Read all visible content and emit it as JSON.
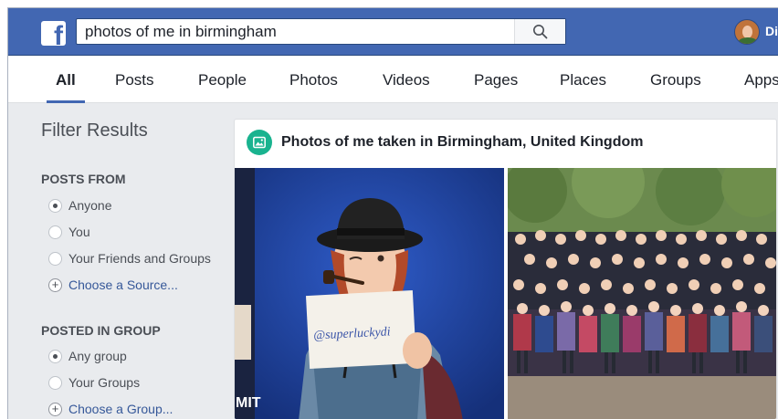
{
  "header": {
    "logo_letter": "f",
    "search_value": "photos of me in birmingham",
    "user_name_partial": "Di"
  },
  "tabs": [
    {
      "label": "All",
      "active": true
    },
    {
      "label": "Posts",
      "active": false
    },
    {
      "label": "People",
      "active": false
    },
    {
      "label": "Photos",
      "active": false
    },
    {
      "label": "Videos",
      "active": false
    },
    {
      "label": "Pages",
      "active": false
    },
    {
      "label": "Places",
      "active": false
    },
    {
      "label": "Groups",
      "active": false
    },
    {
      "label": "Apps",
      "active": false
    }
  ],
  "sidebar": {
    "title": "Filter Results",
    "posts_from": {
      "heading": "POSTS FROM",
      "options": [
        {
          "label": "Anyone",
          "selected": true
        },
        {
          "label": "You",
          "selected": false
        },
        {
          "label": "Your Friends and Groups",
          "selected": false
        }
      ],
      "choose_link": "Choose a Source..."
    },
    "posted_in_group": {
      "heading": "POSTED IN GROUP",
      "options": [
        {
          "label": "Any group",
          "selected": true
        },
        {
          "label": "Your Groups",
          "selected": false
        }
      ],
      "choose_link": "Choose a Group..."
    }
  },
  "results": {
    "card_title": "Photos of me taken in Birmingham, United Kingdom",
    "photo1_sign_text": "@superluckydi",
    "photo1_edge_text": "MIT"
  },
  "colors": {
    "brand_blue": "#4267b2",
    "link_blue": "#365899",
    "photo_icon_green": "#19b38f",
    "page_bg": "#e9ebee"
  },
  "icons": {
    "logo": "facebook-logo-icon",
    "search": "search-icon",
    "photo": "photo-icon",
    "plus": "plus-circle-icon"
  }
}
